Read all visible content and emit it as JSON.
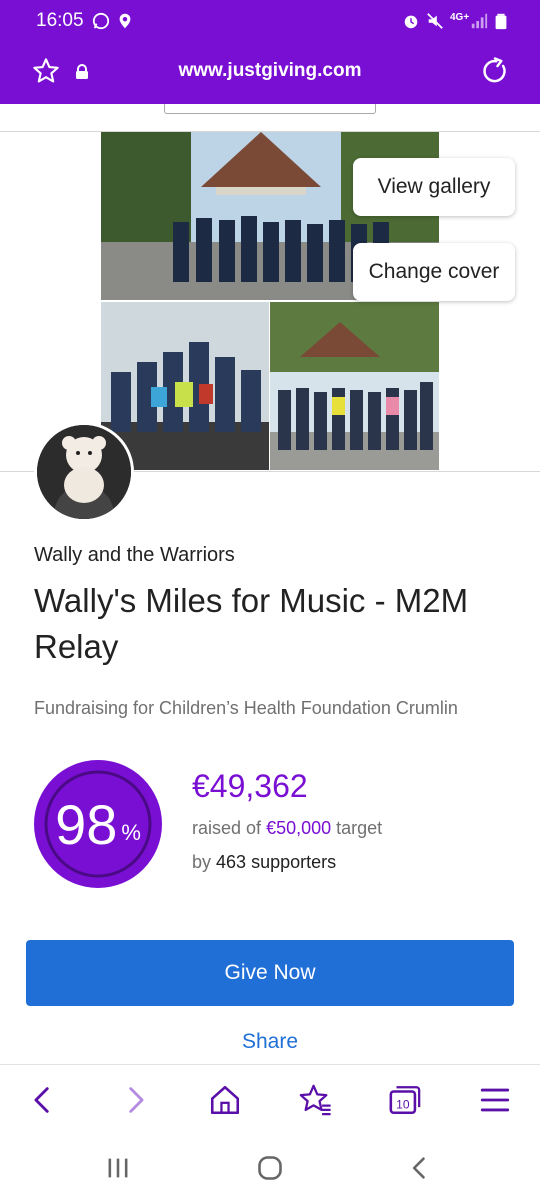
{
  "status_bar": {
    "time": "16:05",
    "network": "4G+",
    "icons": [
      "whatsapp-icon",
      "location-icon",
      "alarm-icon",
      "mute-icon",
      "signal-icon",
      "battery-icon"
    ]
  },
  "browser": {
    "url": "www.justgiving.com",
    "icons": [
      "star-icon",
      "lock-icon",
      "refresh-icon"
    ]
  },
  "cover": {
    "view_gallery_label": "View gallery",
    "change_cover_label": "Change cover"
  },
  "page": {
    "team_name": "Wally and the Warriors",
    "title": "Wally's Miles for Music - M2M Relay",
    "fundraising_for": "Fundraising for Children’s Health Foundation Crumlin"
  },
  "progress": {
    "percent": "98",
    "percent_symbol": "%",
    "percent_fraction": 0.98,
    "raised": "€49,362",
    "raised_prefix": "raised of",
    "target_amount": "€50,000",
    "target_suffix": "target",
    "by_label": "by",
    "supporters": "463 supporters"
  },
  "actions": {
    "give_now_label": "Give Now",
    "share_label": "Share"
  },
  "bottom_nav": {
    "tabs_count": "10",
    "icons": [
      "back-arrow-icon",
      "forward-arrow-icon",
      "home-icon",
      "bookmarks-icon",
      "tabs-icon",
      "menu-icon"
    ]
  },
  "system_nav": {
    "icons": [
      "recents-icon",
      "home-circle-icon",
      "back-icon"
    ]
  },
  "colors": {
    "brand_purple": "#7a0fd4",
    "button_blue": "#1f6fd6",
    "text_dark": "#222222",
    "text_muted": "#707070"
  }
}
